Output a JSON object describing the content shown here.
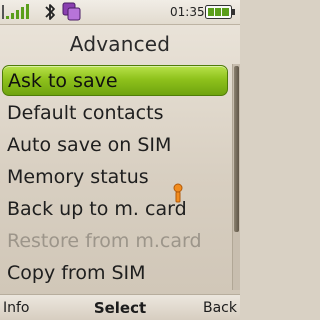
{
  "status": {
    "signal_icon": "signal-strength-icon",
    "bluetooth_icon": "bluetooth-icon",
    "switch_icon": "app-switch-icon",
    "time": "01:35",
    "battery_icon": "battery-icon"
  },
  "header": {
    "title": "Advanced"
  },
  "menu": {
    "items": [
      {
        "label": "Ask to save",
        "state": "selected"
      },
      {
        "label": "Default contacts",
        "state": "normal"
      },
      {
        "label": "Auto save on SIM",
        "state": "normal"
      },
      {
        "label": "Memory status",
        "state": "normal"
      },
      {
        "label": "Back up to m. card",
        "state": "normal"
      },
      {
        "label": "Restore from m.card",
        "state": "disabled"
      },
      {
        "label": "Copy from SIM",
        "state": "normal"
      }
    ]
  },
  "softkeys": {
    "left": "Info",
    "center": "Select",
    "right": "Back"
  },
  "colors": {
    "selection": "#8fc21c",
    "disabled_text": "#9c958a",
    "background": "#d8cfc1"
  }
}
